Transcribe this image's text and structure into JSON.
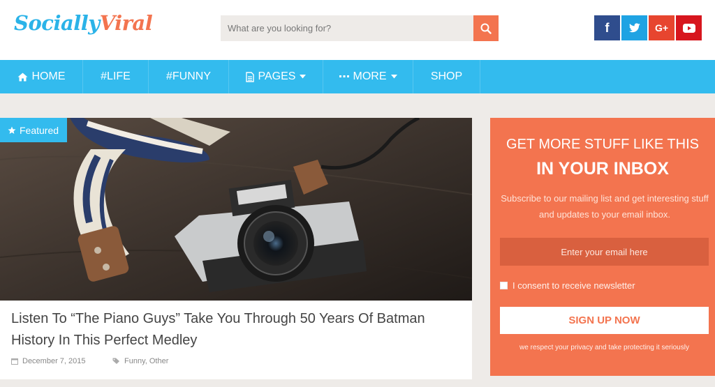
{
  "header": {
    "logo_part1": "Socially",
    "logo_part2": "Viral",
    "search_placeholder": "What are you looking for?",
    "search_icon": "search-icon",
    "social": [
      {
        "name": "facebook",
        "glyph": "f",
        "color": "#2f4d8d"
      },
      {
        "name": "twitter",
        "glyph": "t",
        "color": "#1fa3e3"
      },
      {
        "name": "google-plus",
        "glyph": "G+",
        "color": "#e7452f"
      },
      {
        "name": "youtube",
        "glyph": "▶",
        "color": "#d7161e"
      }
    ]
  },
  "nav": {
    "items": [
      {
        "label": "HOME",
        "icon": "home-icon"
      },
      {
        "label": "#LIFE"
      },
      {
        "label": "#FUNNY"
      },
      {
        "label": "PAGES",
        "icon": "document-icon",
        "dropdown": true
      },
      {
        "label": "MORE",
        "icon": "ellipsis-icon",
        "dropdown": true
      },
      {
        "label": "SHOP"
      }
    ],
    "color": "#33bbee"
  },
  "post": {
    "badge": "Featured",
    "title": "Listen To “The Piano Guys” Take You Through 50 Years Of Batman History In This Perfect Medley",
    "date": "December 7, 2015",
    "tags": "Funny, Other"
  },
  "widget": {
    "title_line1": "GET MORE STUFF LIKE THIS",
    "title_line2": "IN YOUR INBOX",
    "description": "Subscribe to our mailing list and get interesting stuff and updates to your email inbox.",
    "email_placeholder": "Enter your email here",
    "consent": "I consent to receive newsletter",
    "button": "SIGN UP NOW",
    "privacy": "we respect your privacy and take protecting it seriously",
    "color": "#f3744f"
  }
}
